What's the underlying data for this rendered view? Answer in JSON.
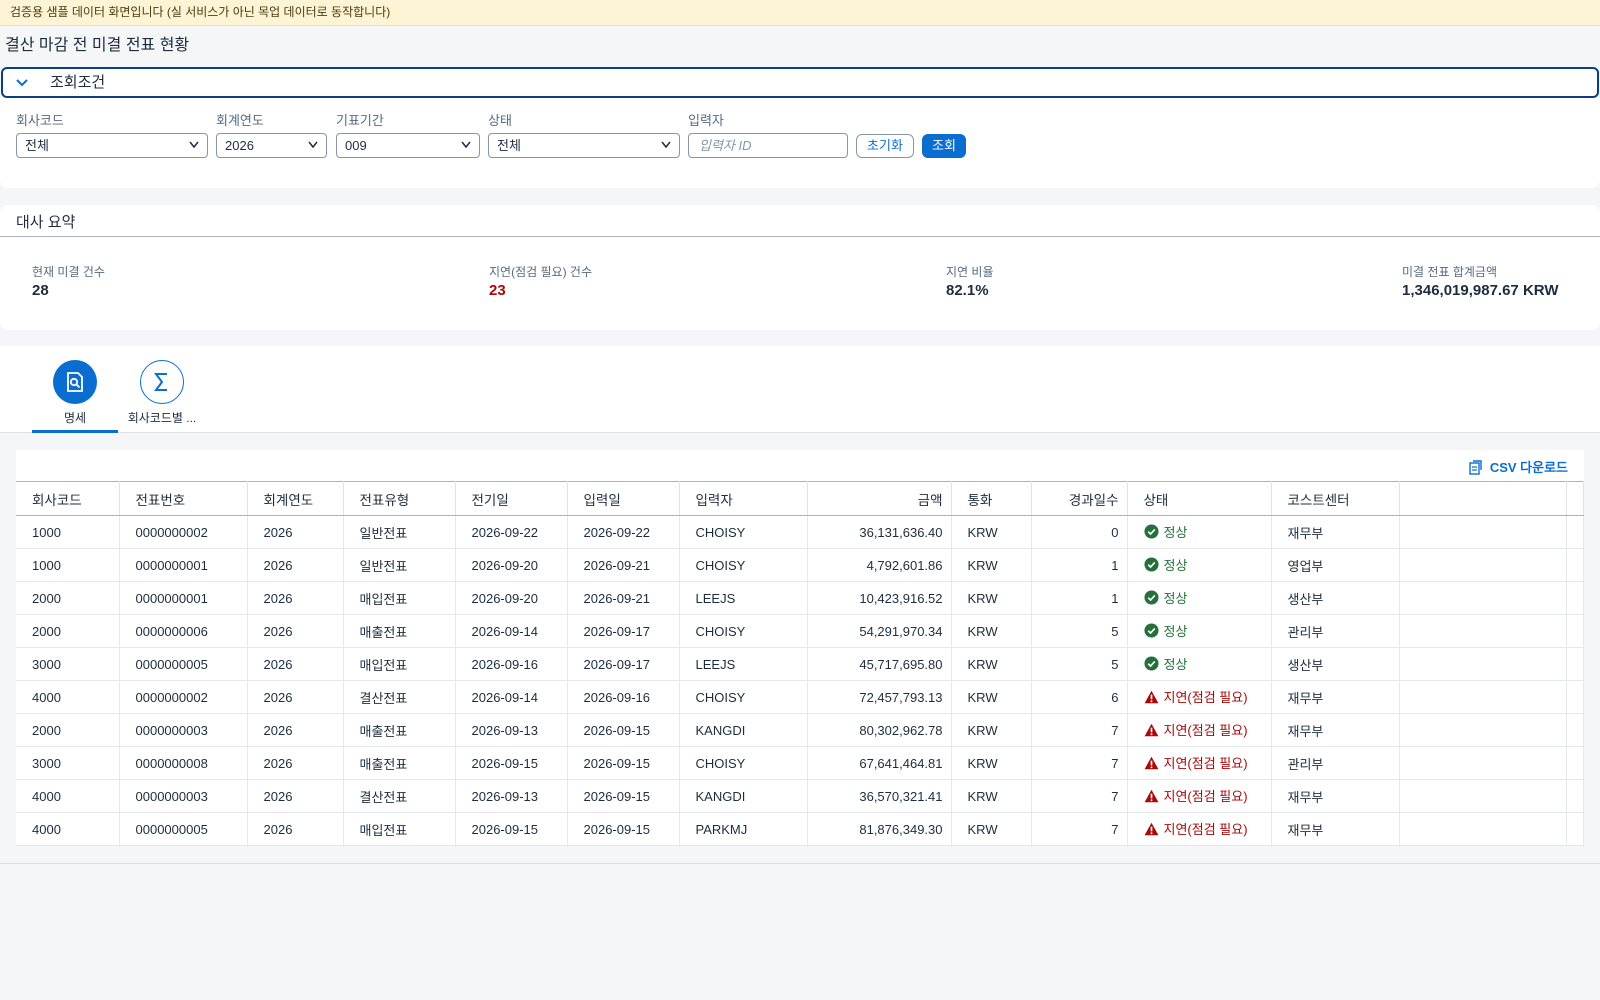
{
  "banner": "검증용 샘플 데이터 화면입니다 (실 서비스가 아닌 목업 데이터로 동작합니다)",
  "page_title": "결산 마감 전 미결 전표 현황",
  "filter": {
    "header": "조회조건",
    "company_label": "회사코드",
    "company_value": "전체",
    "year_label": "회계연도",
    "year_value": "2026",
    "period_label": "기표기간",
    "period_value": "009",
    "status_label": "상태",
    "status_value": "전체",
    "creator_label": "입력자",
    "creator_placeholder": "입력자 ID",
    "reset_label": "초기화",
    "search_label": "조회"
  },
  "summary": {
    "title": "대사 요약",
    "kpis": [
      {
        "label": "현재 미결 건수",
        "value": "28"
      },
      {
        "label": "지연(점검 필요) 건수",
        "value": "23"
      },
      {
        "label": "지연 비율",
        "value": "82.1%"
      },
      {
        "label": "미결 전표 합계금액",
        "value": "1,346,019,987.67 KRW"
      }
    ]
  },
  "tabs": [
    {
      "label": "명세",
      "icon": "document-search-icon"
    },
    {
      "label": "회사코드별 ...",
      "icon": "sum-icon"
    }
  ],
  "table": {
    "csv_label": "CSV 다운로드",
    "columns": [
      "회사코드",
      "전표번호",
      "회계연도",
      "전표유형",
      "전기일",
      "입력일",
      "입력자",
      "금액",
      "통화",
      "경과일수",
      "상태",
      "코스트센터"
    ],
    "rows": [
      [
        "1000",
        "0000000002",
        "2026",
        "일반전표",
        "2026-09-22",
        "2026-09-22",
        "CHOISY",
        "36,131,636.40",
        "KRW",
        "0",
        "정상",
        "재무부"
      ],
      [
        "1000",
        "0000000001",
        "2026",
        "일반전표",
        "2026-09-20",
        "2026-09-21",
        "CHOISY",
        "4,792,601.86",
        "KRW",
        "1",
        "정상",
        "영업부"
      ],
      [
        "2000",
        "0000000001",
        "2026",
        "매입전표",
        "2026-09-20",
        "2026-09-21",
        "LEEJS",
        "10,423,916.52",
        "KRW",
        "1",
        "정상",
        "생산부"
      ],
      [
        "2000",
        "0000000006",
        "2026",
        "매출전표",
        "2026-09-14",
        "2026-09-17",
        "CHOISY",
        "54,291,970.34",
        "KRW",
        "5",
        "정상",
        "관리부"
      ],
      [
        "3000",
        "0000000005",
        "2026",
        "매입전표",
        "2026-09-16",
        "2026-09-17",
        "LEEJS",
        "45,717,695.80",
        "KRW",
        "5",
        "정상",
        "생산부"
      ],
      [
        "4000",
        "0000000002",
        "2026",
        "결산전표",
        "2026-09-14",
        "2026-09-16",
        "CHOISY",
        "72,457,793.13",
        "KRW",
        "6",
        "지연(점검 필요)",
        "재무부"
      ],
      [
        "2000",
        "0000000003",
        "2026",
        "매출전표",
        "2026-09-13",
        "2026-09-15",
        "KANGDI",
        "80,302,962.78",
        "KRW",
        "7",
        "지연(점검 필요)",
        "재무부"
      ],
      [
        "3000",
        "0000000008",
        "2026",
        "매출전표",
        "2026-09-15",
        "2026-09-15",
        "CHOISY",
        "67,641,464.81",
        "KRW",
        "7",
        "지연(점검 필요)",
        "관리부"
      ],
      [
        "4000",
        "0000000003",
        "2026",
        "결산전표",
        "2026-09-13",
        "2026-09-15",
        "KANGDI",
        "36,570,321.41",
        "KRW",
        "7",
        "지연(점검 필요)",
        "재무부"
      ],
      [
        "4000",
        "0000000005",
        "2026",
        "매입전표",
        "2026-09-15",
        "2026-09-15",
        "PARKMJ",
        "81,876,349.30",
        "KRW",
        "7",
        "지연(점검 필요)",
        "재무부"
      ]
    ]
  },
  "colors": {
    "accent": "#0a6ed1",
    "success": "#256f3a",
    "warning": "#aa0808",
    "banner_bg": "#fdf3d5"
  }
}
